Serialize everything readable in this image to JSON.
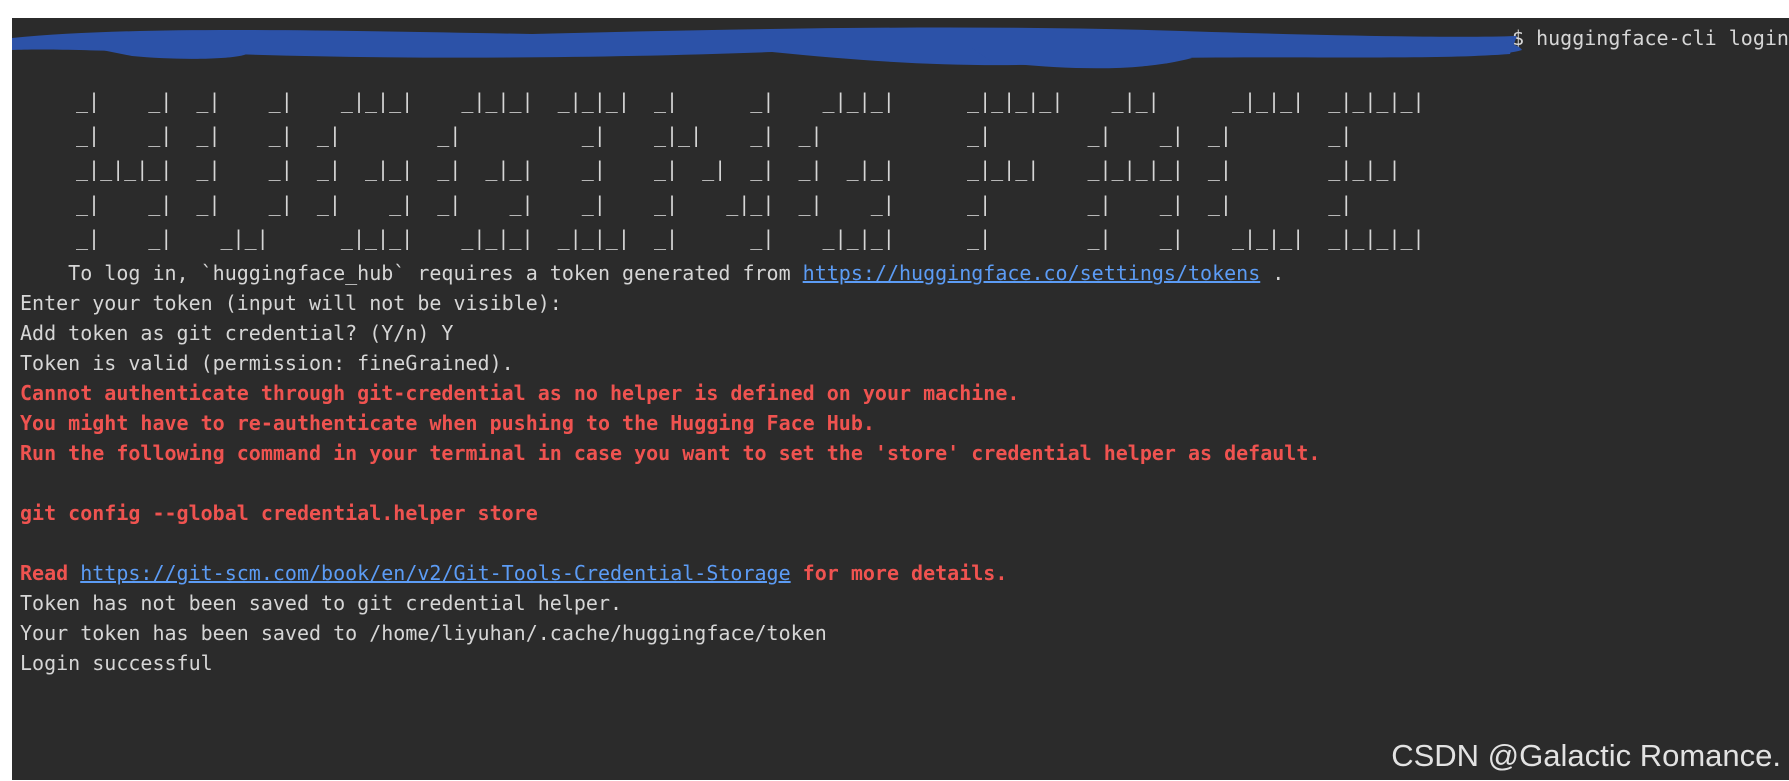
{
  "prompt": {
    "command": "huggingface-cli login"
  },
  "banner": {
    "lines": [
      "_|    _|  _|    _|    _|_|_|    _|_|_|  _|_|_|  _|      _|    _|_|_|      _|_|_|_|    _|_|      _|_|_|  _|_|_|_|",
      "_|    _|  _|    _|  _|        _|          _|    _|_|    _|  _|            _|        _|    _|  _|        _|",
      "_|_|_|_|  _|    _|  _|  _|_|  _|  _|_|    _|    _|  _|  _|  _|  _|_|      _|_|_|    _|_|_|_|  _|        _|_|_|",
      "_|    _|  _|    _|  _|    _|  _|    _|    _|    _|    _|_|  _|    _|      _|        _|    _|  _|        _|",
      "_|    _|    _|_|      _|_|_|    _|_|_|  _|_|_|  _|      _|    _|_|_|      _|        _|    _|    _|_|_|  _|_|_|_|"
    ]
  },
  "output": {
    "login_prefix": "    To log in, `huggingface_hub` requires a token generated from ",
    "tokens_url": "https://huggingface.co/settings/tokens",
    "login_suffix": " .",
    "enter_token": "Enter your token (input will not be visible):",
    "add_git_credential": "Add token as git credential? (Y/n) Y",
    "token_valid": "Token is valid (permission: fineGrained).",
    "err_no_helper": "Cannot authenticate through git-credential as no helper is defined on your machine.",
    "err_reauth": "You might have to re-authenticate when pushing to the Hugging Face Hub.",
    "err_run_command": "Run the following command in your terminal in case you want to set the 'store' credential helper as default.",
    "git_config_cmd": "git config --global credential.helper store",
    "read_prefix": "Read ",
    "git_docs_url": "https://git-scm.com/book/en/v2/Git-Tools-Credential-Storage",
    "read_suffix": " for more details.",
    "not_saved": "Token has not been saved to git credential helper.",
    "saved_path": "Your token has been saved to /home/liyuhan/.cache/huggingface/token",
    "login_success": "Login successful"
  },
  "watermark": "CSDN @Galactic Romance.",
  "colors": {
    "background": "#2b2b2b",
    "text": "#d6d6d6",
    "error": "#ef5350",
    "link": "#5c9cf5",
    "redaction": "#2c52a8"
  }
}
